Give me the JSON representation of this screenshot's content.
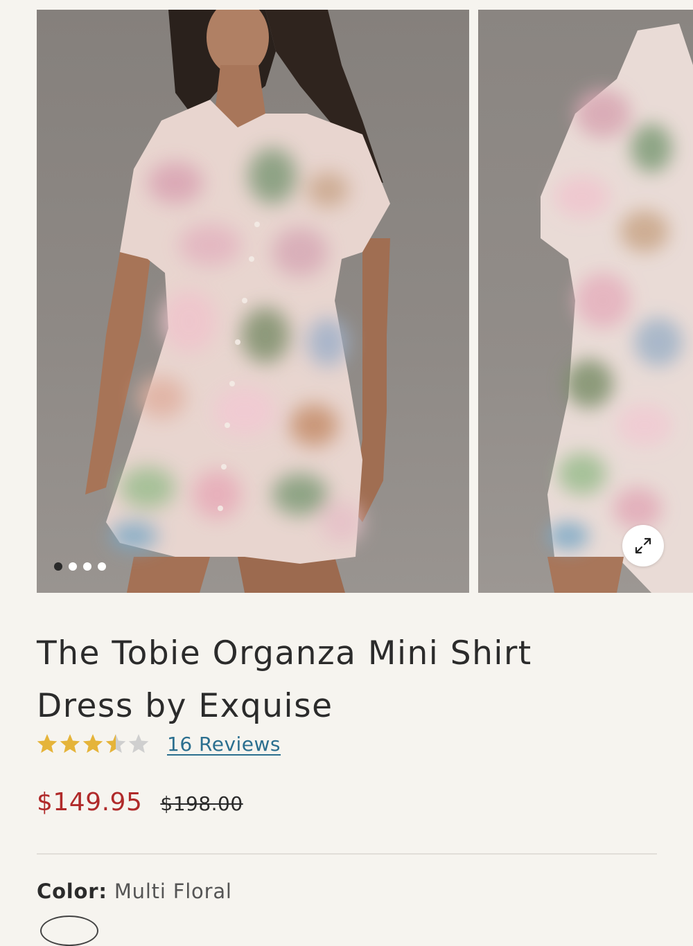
{
  "product": {
    "title_line1": "The Tobie Organza Mini Shirt",
    "title_line2": "Dress by Exquise",
    "rating_stars": 3.5,
    "rating_max": 5,
    "reviews_link": "16 Reviews",
    "sale_price": "$149.95",
    "original_price": "$198.00",
    "color_label": "Color:",
    "color_value": "Multi Floral"
  },
  "gallery": {
    "image_count": 4,
    "active_index": 0,
    "expand_icon": "expand-arrows-icon"
  },
  "colors": {
    "sale_price": "#b02a2a",
    "link": "#2b6f8f",
    "star_filled": "#e5b43a",
    "star_empty": "#cfcfcf",
    "background": "#f6f4ef"
  }
}
